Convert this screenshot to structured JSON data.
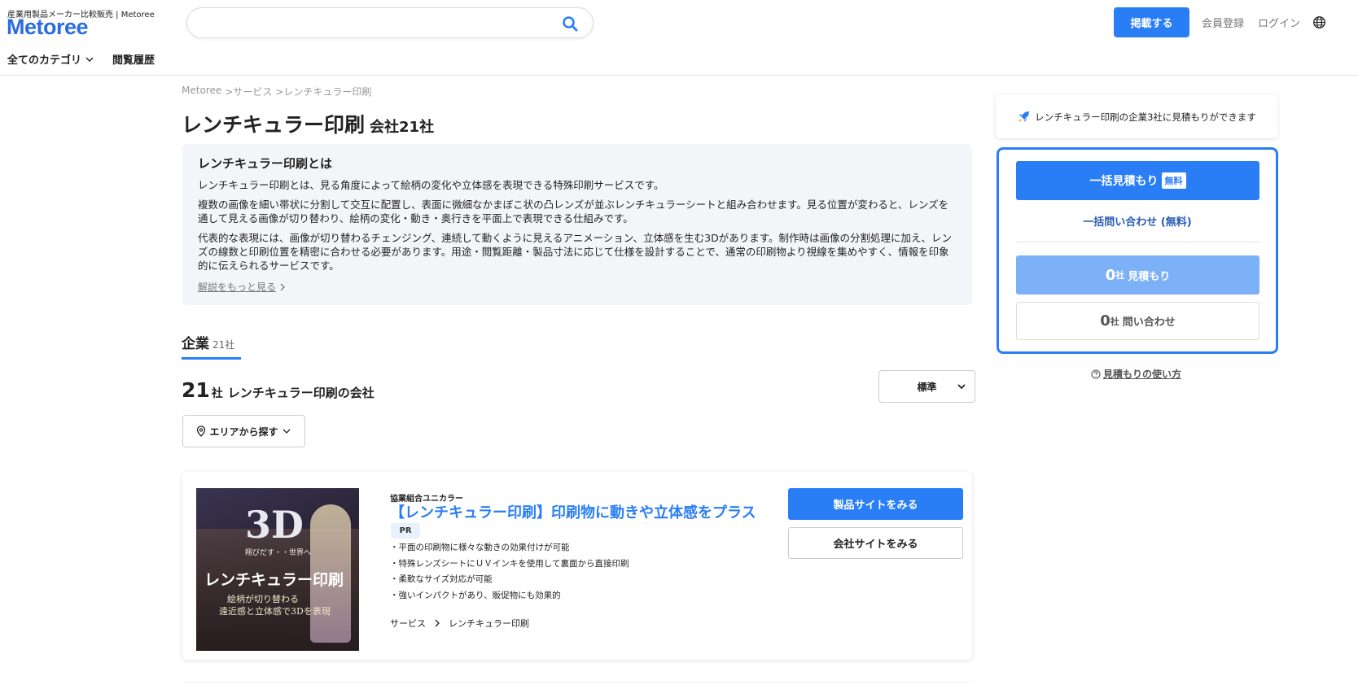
{
  "header": {
    "tagline": "産業用製品メーカー比較販売 | Metoree",
    "logo": "Metoree",
    "search_placeholder": "",
    "post_button": "掲載する",
    "register_link": "会員登録",
    "login_link": "ログイン",
    "nav_categories": "全てのカテゴリ",
    "nav_history": "閲覧履歴"
  },
  "breadcrumb": {
    "items": [
      "Metoree",
      ">サービス",
      ">レンチキュラー印刷"
    ]
  },
  "page": {
    "title": "レンチキュラー印刷",
    "count": "会社21社"
  },
  "description": {
    "title": "レンチキュラー印刷とは",
    "p1": "レンチキュラー印刷とは、見る角度によって絵柄の変化や立体感を表現できる特殊印刷サービスです。",
    "p2": "複数の画像を細い帯状に分割して交互に配置し、表面に微細なかまぼこ状の凸レンズが並ぶレンチキュラーシートと組み合わせます。見る位置が変わると、レンズを通して見える画像が切り替わり、絵柄の変化・動き・奥行きを平面上で表現できる仕組みです。",
    "p3": "代表的な表現には、画像が切り替わるチェンジング、連続して動くように見えるアニメーション、立体感を生む3Dがあります。制作時は画像の分割処理に加え、レンズの線数と印刷位置を精密に合わせる必要があります。用途・閲覧距離・製品寸法に応じて仕様を設計することで、通常の印刷物より視線を集めやすく、情報を印象的に伝えられるサービスです。",
    "more": "解説をもっと見る"
  },
  "tabs": {
    "companies_label": "企業",
    "companies_count": "21社"
  },
  "list": {
    "count": "21",
    "unit": "社",
    "text": "レンチキュラー印刷の会社",
    "sort_value": "標準",
    "area_button": "エリアから探す"
  },
  "card": {
    "image": {
      "big": "3D",
      "sub1": "翔びだす・・世界へ",
      "main": "レンチキュラー印刷",
      "sub2": "絵柄が切り替わる",
      "sub3": "遠近感と立体感で3Dを表現"
    },
    "company": "協業組合ユニカラー",
    "title": "【レンチキュラー印刷】印刷物に動きや立体感をプラス",
    "badge": "PR",
    "features": [
      "・平面の印刷物に様々な動きの効果付けが可能",
      "・特殊レンズシートにＵＶインキを使用して裏面から直接印刷",
      "・柔軟なサイズ対応が可能",
      "・強いインパクトがあり、販促物にも効果的"
    ],
    "crumb1": "サービス",
    "crumb2": "レンチキュラー印刷",
    "product_button": "製品サイトをみる",
    "company_button": "会社サイトをみる"
  },
  "sidebar": {
    "banner": "レンチキュラー印刷の企業3社に見積もりができます",
    "bulk_quote": "一括見積もり",
    "free_badge": "無料",
    "bulk_inquiry": "一括問い合わせ (無料)",
    "quote_count": "0",
    "quote_unit": "社",
    "quote_label": "見積もり",
    "inquiry_count": "0",
    "inquiry_unit": "社",
    "inquiry_label": "問い合わせ",
    "how_to": "見積もりの使い方"
  },
  "colors": {
    "accent": "#2a7ef5",
    "logo": "#2b6de0",
    "disabled_button": "#7cb0f7"
  }
}
